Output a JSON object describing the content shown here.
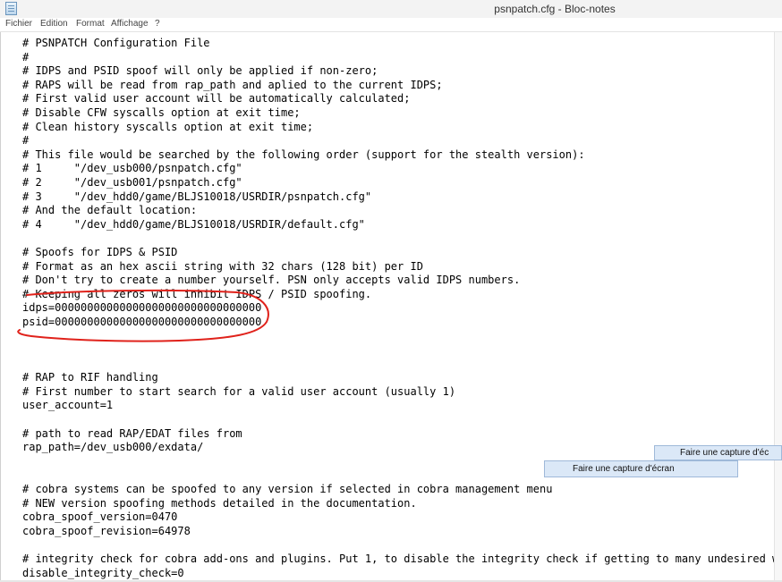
{
  "window": {
    "title": "psnpatch.cfg - Bloc-notes"
  },
  "menu": {
    "items": [
      "Fichier",
      "Edition",
      "Format",
      "Affichage",
      "?"
    ]
  },
  "editor": {
    "lines": [
      "# PSNPATCH Configuration File",
      "#",
      "# IDPS and PSID spoof will only be applied if non-zero;",
      "# RAPS will be read from rap_path and aplied to the current IDPS;",
      "# First valid user account will be automatically calculated;",
      "# Disable CFW syscalls option at exit time;",
      "# Clean history syscalls option at exit time;",
      "#",
      "# This file would be searched by the following order (support for the stealth version):",
      "# 1     \"/dev_usb000/psnpatch.cfg\"",
      "# 2     \"/dev_usb001/psnpatch.cfg\"",
      "# 3     \"/dev_hdd0/game/BLJS10018/USRDIR/psnpatch.cfg\"",
      "# And the default location:",
      "# 4     \"/dev_hdd0/game/BLJS10018/USRDIR/default.cfg\"",
      "",
      "# Spoofs for IDPS & PSID",
      "# Format as an hex ascii string with 32 chars (128 bit) per ID",
      "# Don't try to create a number yourself. PSN only accepts valid IDPS numbers.",
      "# Keeping all zeros will inhibit IDPS / PSID spoofing.",
      "idps=00000000000000000000000000000000",
      "psid=00000000000000000000000000000000",
      "",
      "",
      "",
      "# RAP to RIF handling",
      "# First number to start search for a valid user account (usually 1)",
      "user_account=1",
      "",
      "# path to read RAP/EDAT files from",
      "rap_path=/dev_usb000/exdata/",
      "",
      "",
      "# cobra systems can be spoofed to any version if selected in cobra management menu",
      "# NEW version spoofing methods detailed in the documentation.",
      "cobra_spoof_version=0470",
      "cobra_spoof_revision=64978",
      "",
      "# integrity check for cobra add-ons and plugins. Put 1, to disable the integrity check if getting to many undesired warn",
      "disable_integrity_check=0"
    ]
  },
  "context_menu": {
    "item_top": "Faire une capture d'éc",
    "item_bottom": "Faire une capture d'écran"
  },
  "colors": {
    "annotation_stroke": "#e0221b",
    "menu_highlight": "#dbe8f7"
  },
  "icons": {
    "app": "notepad-icon"
  }
}
